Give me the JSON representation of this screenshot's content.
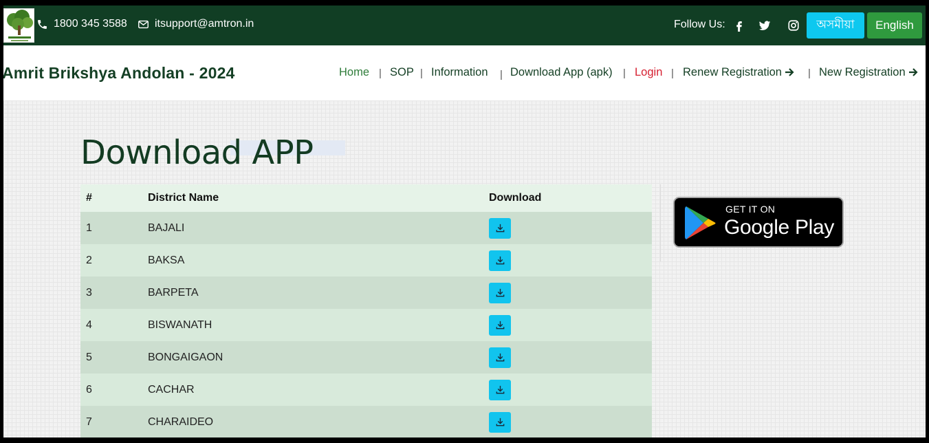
{
  "topbar": {
    "phone": "1800 345 3588",
    "email": "itsupport@amtron.in",
    "follow_label": "Follow Us:",
    "social_icons": [
      "facebook-icon",
      "twitter-icon",
      "instagram-icon"
    ],
    "lang_assamese": "অসমীয়া",
    "lang_english": "English"
  },
  "navbar": {
    "brand": "Amrit Brikshya Andolan - 2024",
    "items": {
      "home": "Home",
      "sop": "SOP",
      "information": "Information",
      "download_app": "Download App (apk)",
      "login": "Login",
      "renew": "Renew Registration",
      "new_reg": "New Registration"
    },
    "separator": "|"
  },
  "main": {
    "title": "Download APP",
    "table": {
      "headers": [
        "#",
        "District Name",
        "Download"
      ],
      "rows": [
        {
          "num": "1",
          "district": "BAJALI"
        },
        {
          "num": "2",
          "district": "BAKSA"
        },
        {
          "num": "3",
          "district": "BARPETA"
        },
        {
          "num": "4",
          "district": "BISWANATH"
        },
        {
          "num": "5",
          "district": "BONGAIGAON"
        },
        {
          "num": "6",
          "district": "CACHAR"
        },
        {
          "num": "7",
          "district": "CHARAIDEO"
        }
      ]
    },
    "google_play": {
      "small": "GET IT ON",
      "big": "Google Play"
    }
  },
  "colors": {
    "topbar_bg": "#113e24",
    "accent_cyan": "#11c4ee",
    "english_green": "#2f9a3e",
    "login_red": "#d62031"
  }
}
